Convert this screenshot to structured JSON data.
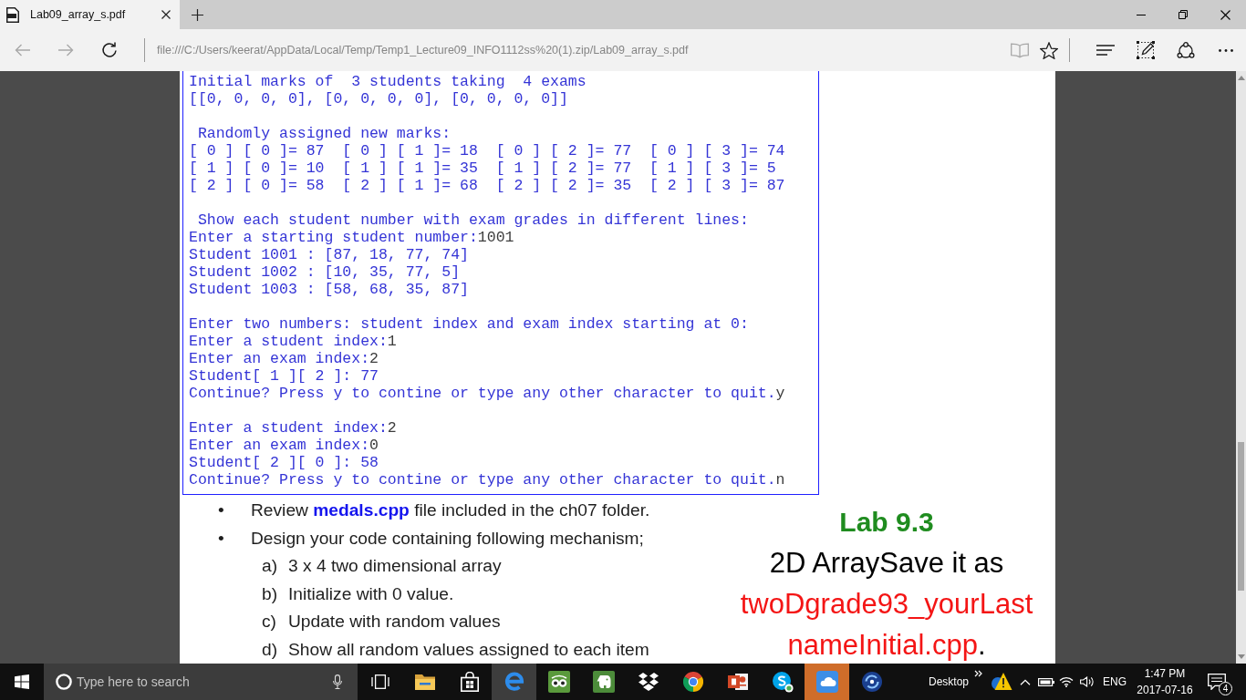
{
  "window": {
    "tabs": [
      {
        "title": "Lab09_array_s.pdf",
        "selected": true
      }
    ]
  },
  "address_bar": {
    "nav": [
      {
        "kind": "back",
        "disabled": true
      },
      {
        "kind": "forward",
        "disabled": true
      },
      {
        "kind": "refresh",
        "disabled": false
      }
    ],
    "url": "file:///C:/Users/keerat/AppData/Local/Temp/Temp1_Lecture09_INFO1112ss%20(1).zip/Lab09_array_s.pdf",
    "tools": [
      {
        "kind": "reading",
        "disabled": true
      },
      {
        "kind": "favorite",
        "disabled": false
      },
      {
        "kind": "hub",
        "disabled": false
      },
      {
        "kind": "notes",
        "disabled": false
      },
      {
        "kind": "share",
        "disabled": false
      },
      {
        "kind": "more",
        "disabled": false
      }
    ]
  },
  "console": {
    "blocks": [
      [
        {
          "text": "Initial marks of  3 students taking  4 exams"
        },
        {
          "text": "[[0, 0, 0, 0], [0, 0, 0, 0], [0, 0, 0, 0]]"
        }
      ],
      [
        {
          "text": " Randomly assigned new marks:"
        },
        {
          "text": "[ 0 ] [ 0 ]= 87  [ 0 ] [ 1 ]= 18  [ 0 ] [ 2 ]= 77  [ 0 ] [ 3 ]= 74"
        },
        {
          "text": "[ 1 ] [ 0 ]= 10  [ 1 ] [ 1 ]= 35  [ 1 ] [ 2 ]= 77  [ 1 ] [ 3 ]= 5"
        },
        {
          "text": "[ 2 ] [ 0 ]= 58  [ 2 ] [ 1 ]= 68  [ 2 ] [ 2 ]= 35  [ 2 ] [ 3 ]= 87"
        }
      ],
      [
        {
          "text": " Show each student number with exam grades in different lines:"
        },
        {
          "text": "Enter a starting student number:",
          "input": "1001"
        },
        {
          "text": "Student 1001 : [87, 18, 77, 74]"
        },
        {
          "text": "Student 1002 : [10, 35, 77, 5]"
        },
        {
          "text": "Student 1003 : [58, 68, 35, 87]"
        }
      ],
      [
        {
          "text": "Enter two numbers: student index and exam index starting at 0:"
        },
        {
          "text": "Enter a student index:",
          "input": "1"
        },
        {
          "text": "Enter an exam index:",
          "input": "2"
        },
        {
          "text": "Student[ 1 ][ 2 ]: 77"
        },
        {
          "text": "Continue? Press y to contine or type any other character to quit.",
          "input": "y"
        }
      ],
      [
        {
          "text": "Enter a student index:",
          "input": "2"
        },
        {
          "text": "Enter an exam index:",
          "input": "0"
        },
        {
          "text": "Student[ 2 ][ 0 ]: 58"
        },
        {
          "text": "Continue? Press y to contine or type any other character to quit.",
          "input": "n"
        }
      ]
    ]
  },
  "slide": {
    "bullets": [
      {
        "marker": "•",
        "text": "Review **medals.cpp** file included in the ch07 folder."
      },
      {
        "marker": "•",
        "text": "Design your code containing following mechanism;",
        "children": [
          {
            "marker": "a)",
            "text": "3 x 4 two dimensional array"
          },
          {
            "marker": "b)",
            "text": "Initialize with 0 value."
          },
          {
            "marker": "c)",
            "text": "Update with random values"
          },
          {
            "marker": "d)",
            "text": "Show all random values assigned to each item"
          }
        ]
      }
    ],
    "lab": {
      "heading": "Lab 9.3",
      "subtitle": "2D ArraySave it as",
      "file_name_lines": [
        "twoDgrade93_yourLast",
        "nameInitial.cpp"
      ],
      "closing": "."
    }
  },
  "taskbar": {
    "search": {
      "placeholder": "Type here to search"
    },
    "apps": [
      {
        "kind": "folder",
        "active": false,
        "flashing": false
      },
      {
        "kind": "bag",
        "active": false,
        "flashing": false
      },
      {
        "kind": "e-logo",
        "active": true,
        "flashing": false
      },
      {
        "kind": "owl",
        "active": false,
        "flashing": false
      },
      {
        "kind": "elephant",
        "active": false,
        "flashing": false
      },
      {
        "kind": "diamonds",
        "active": false,
        "flashing": false
      },
      {
        "kind": "wheel",
        "active": false,
        "flashing": false
      },
      {
        "kind": "slides",
        "active": false,
        "flashing": false
      },
      {
        "kind": "bubble",
        "active": false,
        "flashing": false
      },
      {
        "kind": "cloud",
        "active": false,
        "flashing": true
      },
      {
        "kind": "sync",
        "active": false,
        "flashing": false
      }
    ],
    "desktop_label": "Desktop",
    "language": "ENG",
    "time": "1:47 PM",
    "date": "2017-07-16",
    "notification_count": "4"
  }
}
